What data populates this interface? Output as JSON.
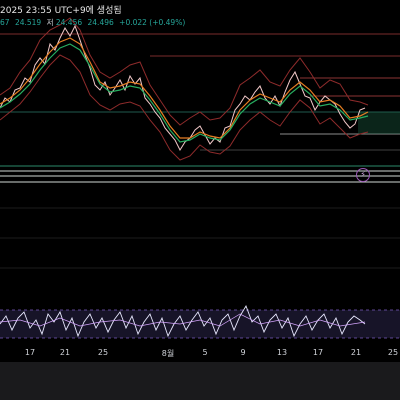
{
  "header": {
    "title": "2025 23:55 UTC+9에 생성됨",
    "ohlc": {
      "prefix": "67",
      "high": "24.519",
      "low_label": "저",
      "low": "24.456",
      "close": "24.496",
      "change": "+0.022 (+0.49%)"
    }
  },
  "xaxis": {
    "labels": [
      "17",
      "21",
      "25",
      "8월",
      "5",
      "9",
      "13",
      "17",
      "21",
      "25"
    ]
  },
  "badge": {
    "symbol": "⚡"
  },
  "colors": {
    "background": "#000000",
    "price_line": "#f7c6c6",
    "ma_fast": "#e67e22",
    "ma_slow": "#27ae60",
    "band": "#c0392b",
    "rsi_line": "#e8e8ff",
    "rsi_band": "#7b5cc0",
    "positive": "#26a69a"
  }
}
